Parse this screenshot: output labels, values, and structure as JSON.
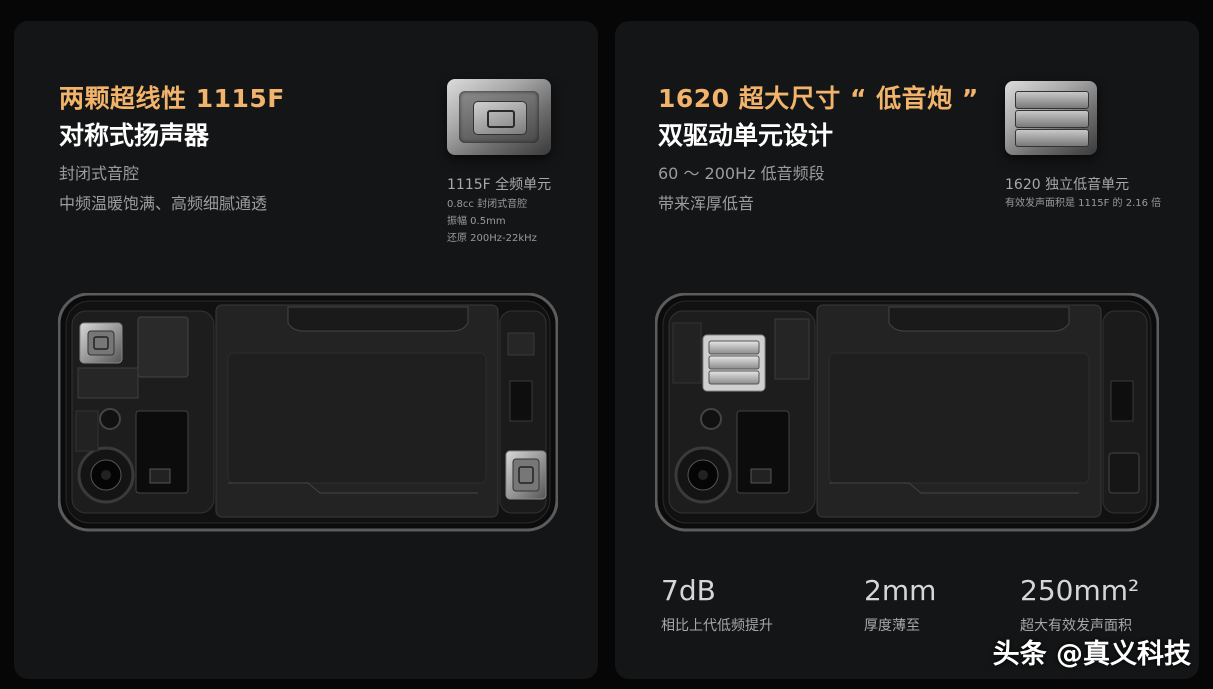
{
  "left": {
    "title_line1": "两颗超线性 1115F",
    "title_line2": "对称式扬声器",
    "desc_line1": "封闭式音腔",
    "desc_line2": "中频温暖饱满、高频细腻通透",
    "spec_name": "1115F 全频单元",
    "spec_details": [
      "0.8cc 封闭式音腔",
      "振幅 0.5mm",
      "还原 200Hz-22kHz"
    ],
    "title_color": "#f2b46a"
  },
  "right": {
    "title_line1": "1620 超大尺寸 “ 低音炮 ”",
    "title_line2": "双驱动单元设计",
    "desc_line1": "60 ～ 200Hz 低音频段",
    "desc_line2": "带来浑厚低音",
    "spec_name": "1620 独立低音单元",
    "spec_detail": "有效发声面积是 1115F 的 2.16 倍",
    "stats": [
      {
        "value": "7dB",
        "label": "相比上代低频提升"
      },
      {
        "value": "2mm",
        "label": "厚度薄至"
      },
      {
        "value": "250mm²",
        "label": "超大有效发声面积"
      }
    ]
  },
  "watermark": "头条 @真义科技",
  "icons": [
    "speaker-chip-icon",
    "bass-chip-icon",
    "phone-internals-image"
  ]
}
